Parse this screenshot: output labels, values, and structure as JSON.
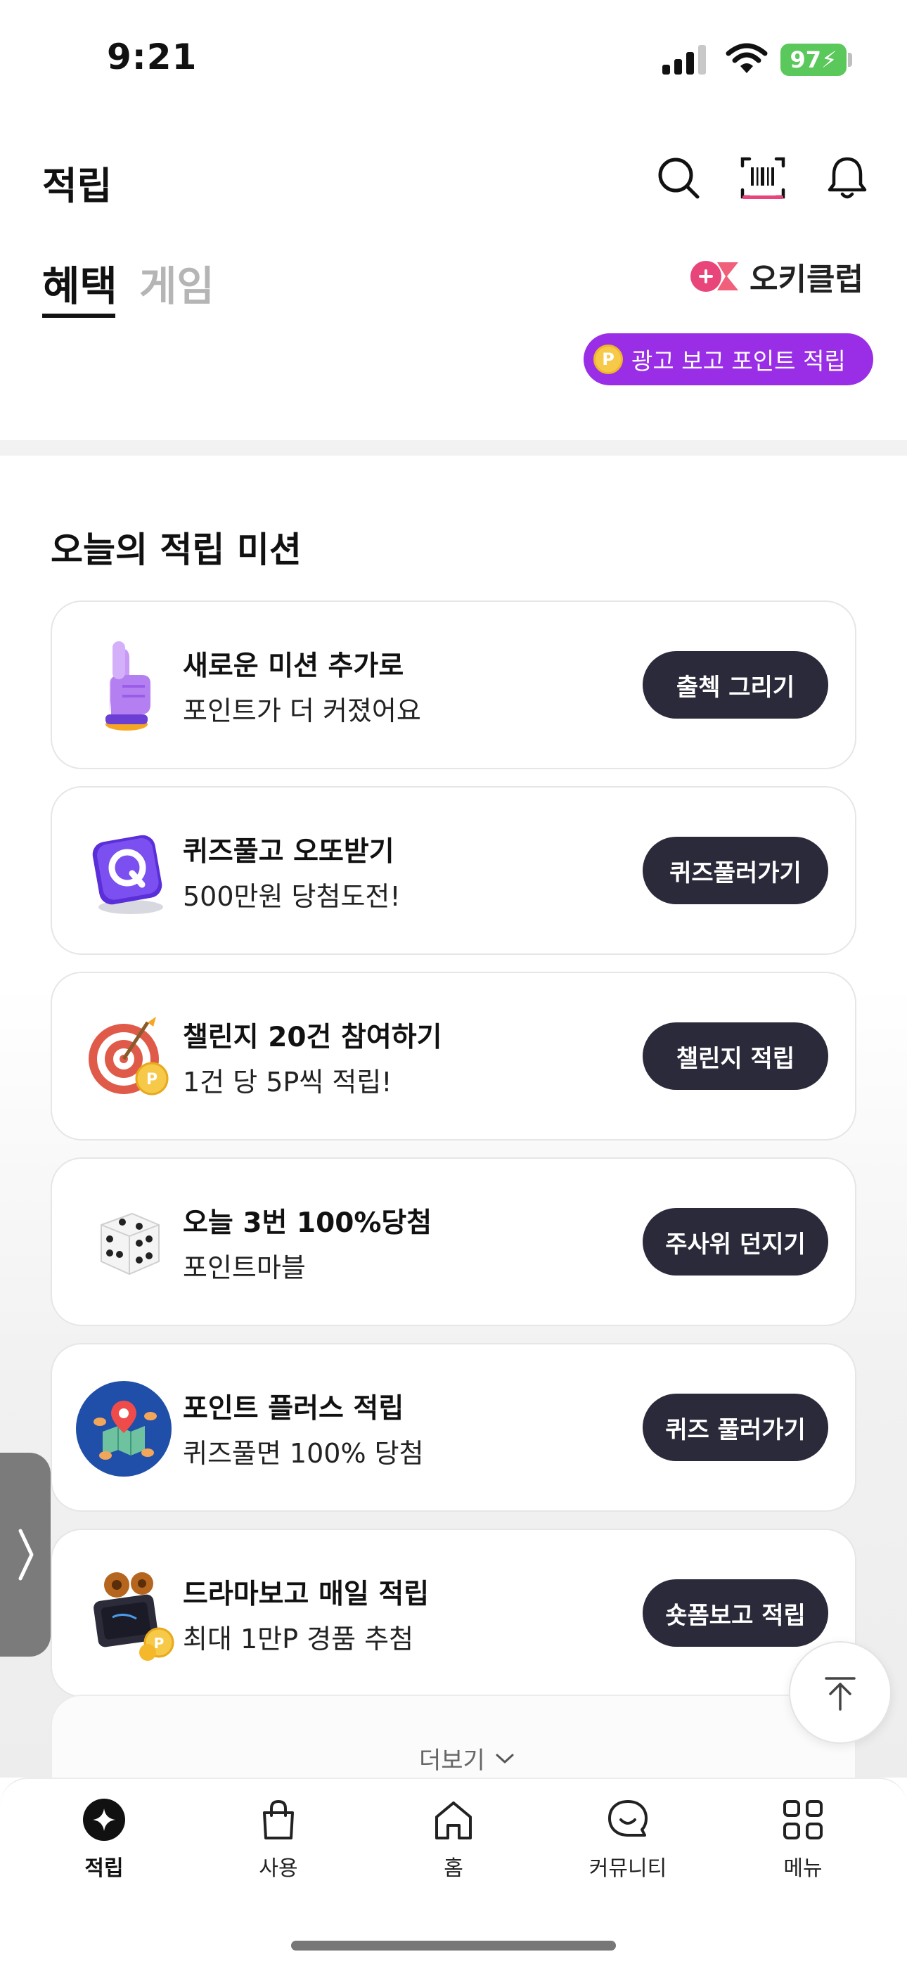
{
  "status_bar": {
    "time": "9:21",
    "battery": "97"
  },
  "header": {
    "title": "적립",
    "icons": [
      "search-icon",
      "barcode-scan-icon",
      "bell-icon"
    ]
  },
  "tabs": [
    {
      "label": "혜택",
      "active": true
    },
    {
      "label": "게임",
      "active": false
    }
  ],
  "okclub": {
    "label": "오키클럽"
  },
  "ad_button": {
    "coin": "P",
    "label": "광고 보고 포인트 적립"
  },
  "missions": {
    "title": "오늘의 적립 미션",
    "items": [
      {
        "icon": "pointing-hand-icon",
        "title": "새로운 미션 추가로",
        "subtitle": "포인트가 더 커졌어요",
        "button": "출첵 그리기"
      },
      {
        "icon": "quiz-q-cube-icon",
        "title": "퀴즈풀고 오또받기",
        "subtitle": "500만원 당첨도전!",
        "button": "퀴즈풀러가기"
      },
      {
        "icon": "target-dart-icon",
        "title": "챌린지 20건 참여하기",
        "subtitle": "1건 당 5P씩 적립!",
        "button": "챌린지 적립"
      },
      {
        "icon": "dice-icon",
        "title": "오늘 3번 100%당첨",
        "subtitle": "포인트마블",
        "button": "주사위 던지기"
      },
      {
        "icon": "map-pin-globe-icon",
        "title": "포인트 플러스 적립",
        "subtitle": "퀴즈풀면 100% 당첨",
        "button": "퀴즈 풀러가기"
      },
      {
        "icon": "movie-camera-icon",
        "title": "드라마보고 매일 적립",
        "subtitle": "최대 1만P 경품 추첨",
        "button": "숏폼보고 적립"
      }
    ],
    "more_label": "더보기"
  },
  "bottom_nav": [
    {
      "icon": "sparkle-coin-icon",
      "label": "적립",
      "active": true
    },
    {
      "icon": "shopping-bag-icon",
      "label": "사용",
      "active": false
    },
    {
      "icon": "home-icon",
      "label": "홈",
      "active": false
    },
    {
      "icon": "chat-bubble-icon",
      "label": "커뮤니티",
      "active": false
    },
    {
      "icon": "grid-menu-icon",
      "label": "메뉴",
      "active": false
    }
  ],
  "colors": {
    "accent_purple": "#9a2ee6",
    "button_dark": "#2a2a3a",
    "okclub_pink": "#e8457a",
    "battery_green": "#5ac85a"
  }
}
